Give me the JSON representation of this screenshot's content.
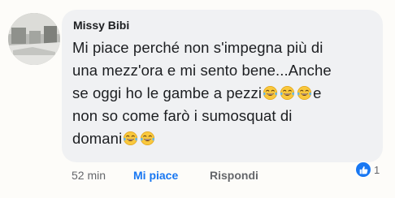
{
  "comment": {
    "author": "Missy Bibi",
    "lines": [
      "Mi piace perché  non s'impegna più  di",
      "una mezz'ora e mi sento bene...Anche",
      "se oggi ho le gambe a pezzi",
      "e",
      "non so come farò  i sumosquat di",
      "domani"
    ],
    "emoji_name": "laughing-tears-emoji"
  },
  "actions": {
    "time": "52 min",
    "like_label": "Mi piace",
    "reply_label": "Rispondi"
  },
  "reactions": {
    "icon": "like-thumb-icon",
    "count": "1"
  },
  "colors": {
    "accent": "#1877f2",
    "bubble": "#f0f1f3",
    "muted": "#65676b",
    "text": "#1c1e21"
  }
}
